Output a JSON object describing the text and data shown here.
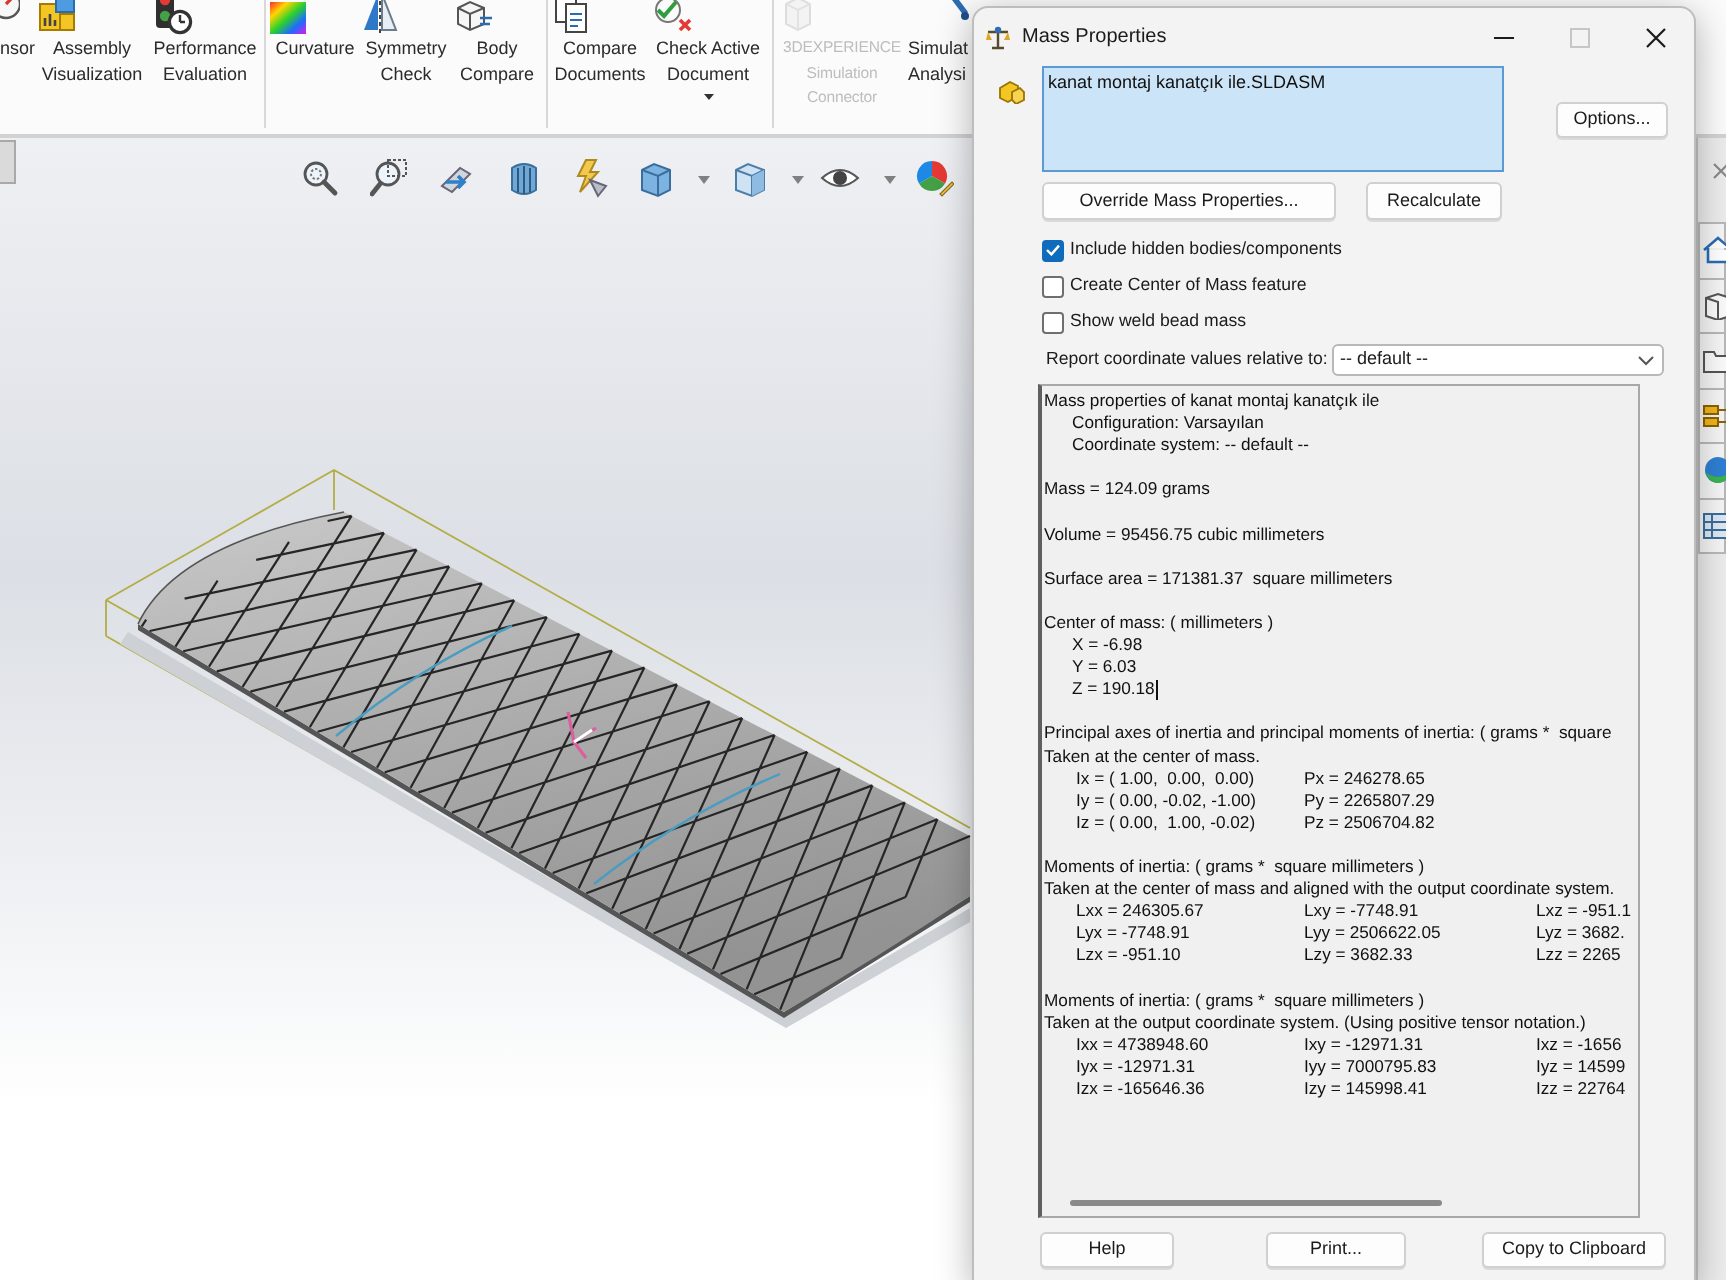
{
  "ribbon": {
    "groups": [
      {
        "buttons": [
          {
            "lines": [
              "nsor"
            ],
            "disabled": false,
            "dropdown": false
          },
          {
            "lines": [
              "Assembly",
              "Visualization"
            ],
            "disabled": false,
            "dropdown": false
          },
          {
            "lines": [
              "Performance",
              "Evaluation"
            ],
            "disabled": false,
            "dropdown": false
          }
        ]
      },
      {
        "buttons": [
          {
            "lines": [
              "Curvature"
            ],
            "disabled": false,
            "dropdown": false
          },
          {
            "lines": [
              "Symmetry",
              "Check"
            ],
            "disabled": false,
            "dropdown": false
          },
          {
            "lines": [
              "Body",
              "Compare"
            ],
            "disabled": false,
            "dropdown": false
          }
        ]
      },
      {
        "buttons": [
          {
            "lines": [
              "Compare",
              "Documents"
            ],
            "disabled": false,
            "dropdown": false
          },
          {
            "lines": [
              "Check Active",
              "Document"
            ],
            "disabled": false,
            "dropdown": true
          }
        ]
      },
      {
        "buttons": [
          {
            "lines": [
              "3DEXPERIENCE",
              "Simulation",
              "Connector"
            ],
            "disabled": true,
            "dropdown": false
          },
          {
            "lines": [
              "Simulat",
              "Analysi"
            ],
            "disabled": false,
            "dropdown": false
          }
        ]
      }
    ]
  },
  "dialog": {
    "title": "Mass Properties",
    "window_controls": [
      {
        "kind": "minimize",
        "disabled": false
      },
      {
        "kind": "maximize",
        "disabled": true
      },
      {
        "kind": "close",
        "disabled": false
      }
    ],
    "selection": {
      "active": true,
      "items": [
        "kanat montaj kanatçık ile.SLDASM"
      ]
    },
    "options_button": "Options...",
    "action_buttons": [
      "Override Mass Properties...",
      "Recalculate"
    ],
    "checkboxes": [
      {
        "label": "Include hidden bodies/components",
        "checked": true
      },
      {
        "label": "Create Center of Mass feature",
        "checked": false
      },
      {
        "label": "Show weld bead mass",
        "checked": false
      }
    ],
    "coordinate_select": {
      "label": "Report coordinate values relative to:",
      "value": "-- default --"
    },
    "report": {
      "sections": [
        {
          "lines": [
            {
              "kind": "plain",
              "text": "Mass properties of kanat montaj kanatçık ile",
              "cursor": false
            },
            {
              "kind": "indented",
              "text": "Configuration: Varsayılan",
              "cursor": false
            },
            {
              "kind": "indented",
              "text": "Coordinate system: -- default --",
              "cursor": false
            }
          ]
        },
        {
          "lines": [
            {
              "kind": "plain",
              "text": "Mass = 124.09 grams",
              "cursor": false
            }
          ]
        },
        {
          "lines": [
            {
              "kind": "plain",
              "text": "Volume = 95456.75 cubic millimeters",
              "cursor": false
            }
          ]
        },
        {
          "lines": [
            {
              "kind": "plain",
              "text": "Surface area = 171381.37  square millimeters",
              "cursor": false
            }
          ]
        },
        {
          "lines": [
            {
              "kind": "plain",
              "text": "Center of mass: ( millimeters )",
              "cursor": false
            },
            {
              "kind": "indented",
              "text": "X = -6.98",
              "cursor": false
            },
            {
              "kind": "indented",
              "text": "Y = 6.03",
              "cursor": false
            },
            {
              "kind": "indented",
              "text": "Z = 190.18",
              "cursor": true
            }
          ]
        },
        {
          "lines": [
            {
              "kind": "plain",
              "text": "Principal axes of inertia and principal moments of inertia: ( grams *  square",
              "cursor": false
            },
            {
              "kind": "plain",
              "text": "Taken at the center of mass.",
              "cursor": false
            },
            {
              "kind": "columns",
              "cells": [
                "Ix = ( 1.00,  0.00,  0.00)",
                "Px = 246278.65"
              ],
              "cursor": false
            },
            {
              "kind": "columns",
              "cells": [
                "Iy = ( 0.00, -0.02, -1.00)",
                "Py = 2265807.29"
              ],
              "cursor": false
            },
            {
              "kind": "columns",
              "cells": [
                "Iz = ( 0.00,  1.00, -0.02)",
                "Pz = 2506704.82"
              ],
              "cursor": false
            }
          ]
        },
        {
          "lines": [
            {
              "kind": "plain",
              "text": "Moments of inertia: ( grams *  square millimeters )",
              "cursor": false
            },
            {
              "kind": "plain",
              "text": "Taken at the center of mass and aligned with the output coordinate system.",
              "cursor": false
            },
            {
              "kind": "columns",
              "cells": [
                "Lxx = 246305.67",
                "Lxy = -7748.91",
                "Lxz = -951.1"
              ],
              "cursor": false
            },
            {
              "kind": "columns",
              "cells": [
                "Lyx = -7748.91",
                "Lyy = 2506622.05",
                "Lyz = 3682."
              ],
              "cursor": false
            },
            {
              "kind": "columns",
              "cells": [
                "Lzx = -951.10",
                "Lzy = 3682.33",
                "Lzz = 2265"
              ],
              "cursor": false
            }
          ]
        },
        {
          "lines": [
            {
              "kind": "plain",
              "text": "Moments of inertia: ( grams *  square millimeters )",
              "cursor": false
            },
            {
              "kind": "plain",
              "text": "Taken at the output coordinate system. (Using positive tensor notation.)",
              "cursor": false
            },
            {
              "kind": "columns",
              "cells": [
                "Ixx = 4738948.60",
                "Ixy = -12971.31",
                "Ixz = -1656"
              ],
              "cursor": false
            },
            {
              "kind": "columns",
              "cells": [
                "Iyx = -12971.31",
                "Iyy = 7000795.83",
                "Iyz = 14599"
              ],
              "cursor": false
            },
            {
              "kind": "columns",
              "cells": [
                "Izx = -165646.36",
                "Izy = 145998.41",
                "Izz = 22764"
              ],
              "cursor": false
            }
          ]
        }
      ]
    },
    "footer_buttons": [
      "Help",
      "Print...",
      "Copy to Clipboard"
    ]
  }
}
